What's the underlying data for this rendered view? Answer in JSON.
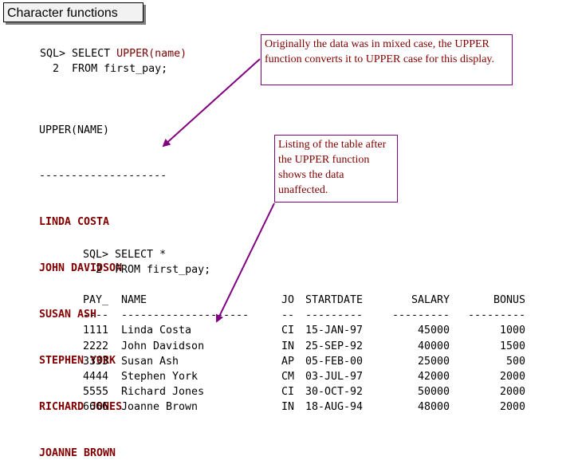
{
  "title": "Character functions",
  "query1": {
    "prompt1": "SQL>",
    "cmd1": "SELECT",
    "func": "UPPER(name)",
    "prompt2": "2",
    "cmd2": "FROM first_pay;"
  },
  "result1": {
    "header": "UPPER(NAME)",
    "divider": "--------------------",
    "rows": [
      "LINDA COSTA",
      "JOHN DAVIDSON",
      "SUSAN ASH",
      "STEPHEN YORK",
      "RICHARD JONES",
      "JOANNE BROWN"
    ]
  },
  "callout1": "Originally the data was in mixed case, the UPPER function converts it to UPPER case for this display.",
  "callout2": "Listing of the table after the UPPER function shows the data unaffected.",
  "query2": {
    "line1": "SQL> SELECT *",
    "line2": "  2  FROM first_pay;"
  },
  "result2": {
    "headers": [
      "PAY_",
      "NAME",
      "JO",
      "STARTDATE",
      "SALARY",
      "BONUS"
    ],
    "dividers": [
      "----",
      "--------------------",
      "--",
      "---------",
      "---------",
      "---------"
    ],
    "rows": [
      [
        "1111",
        "Linda Costa",
        "CI",
        "15-JAN-97",
        "45000",
        "1000"
      ],
      [
        "2222",
        "John Davidson",
        "IN",
        "25-SEP-92",
        "40000",
        "1500"
      ],
      [
        "3333",
        "Susan Ash",
        "AP",
        "05-FEB-00",
        "25000",
        "500"
      ],
      [
        "4444",
        "Stephen York",
        "CM",
        "03-JUL-97",
        "42000",
        "2000"
      ],
      [
        "5555",
        "Richard Jones",
        "CI",
        "30-OCT-92",
        "50000",
        "2000"
      ],
      [
        "6666",
        "Joanne Brown",
        "IN",
        "18-AUG-94",
        "48000",
        "2000"
      ]
    ]
  },
  "colors": {
    "accent": "#800080",
    "keyword": "#800000",
    "title_bg": "#f2f2f2"
  }
}
